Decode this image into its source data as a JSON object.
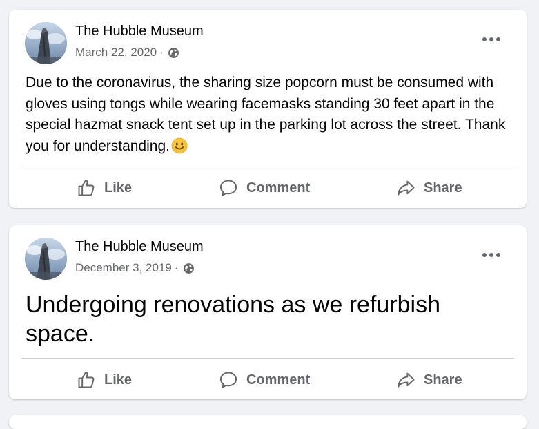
{
  "posts": [
    {
      "author": "The Hubble Museum",
      "date": "March 22, 2020",
      "separator": "·",
      "privacy_icon": "globe-icon",
      "text": "Due to the coronavirus, the sharing size popcorn must be consumed with gloves using tongs while wearing facemasks standing 30 feet apart in the special hazmat snack tent set up in the parking lot across the street.  Thank you for understanding.",
      "emoji": "slightly-smiling-face-emoji",
      "actions": {
        "like": "Like",
        "comment": "Comment",
        "share": "Share"
      }
    },
    {
      "author": "The Hubble Museum",
      "date": "December 3, 2019",
      "separator": "·",
      "privacy_icon": "globe-icon",
      "text": "Undergoing renovations as we refurbish space.",
      "actions": {
        "like": "Like",
        "comment": "Comment",
        "share": "Share"
      }
    }
  ],
  "colors": {
    "background": "#f0f2f5",
    "card": "#ffffff",
    "secondary_text": "#65676b",
    "divider": "#ced0d4",
    "emoji_yellow": "#f7c33b"
  }
}
